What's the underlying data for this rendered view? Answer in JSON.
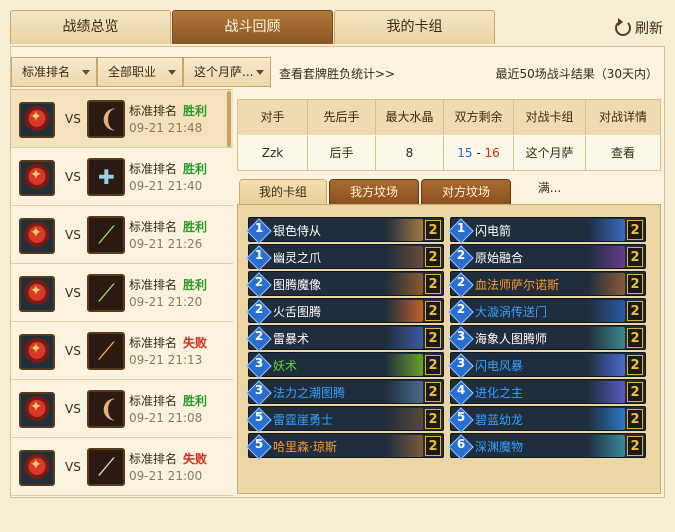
{
  "tabs": [
    "战绩总览",
    "战斗回顾",
    "我的卡组"
  ],
  "refresh_label": "刷新",
  "filters": {
    "mode": "标准排名",
    "class": "全部职业",
    "deck": "这个月萨..."
  },
  "stats_link": "查看套牌胜负统计>>",
  "summary": "最近50场战斗结果（30天内）",
  "matches": [
    {
      "vs": "VS",
      "mode": "标准排名",
      "result": "胜利",
      "time": "09-21 21:48"
    },
    {
      "vs": "VS",
      "mode": "标准排名",
      "result": "胜利",
      "time": "09-21 21:40"
    },
    {
      "vs": "VS",
      "mode": "标准排名",
      "result": "胜利",
      "time": "09-21 21:26"
    },
    {
      "vs": "VS",
      "mode": "标准排名",
      "result": "胜利",
      "time": "09-21 21:20"
    },
    {
      "vs": "VS",
      "mode": "标准排名",
      "result": "失败",
      "time": "09-21 21:13"
    },
    {
      "vs": "VS",
      "mode": "标准排名",
      "result": "胜利",
      "time": "09-21 21:08"
    },
    {
      "vs": "VS",
      "mode": "标准排名",
      "result": "失败",
      "time": "09-21 21:00"
    }
  ],
  "table": {
    "headers": [
      "对手",
      "先后手",
      "最大水晶",
      "双方剩余",
      "对战卡组",
      "对战详情"
    ],
    "opponent": "Zzk",
    "turn": "后手",
    "max_mana": "8",
    "remaining_mine": "15",
    "remaining_sep": " - ",
    "remaining_theirs": "16",
    "deck": "这个月萨满...",
    "detail": "查看"
  },
  "deck_tabs": [
    "我的卡组",
    "我方坟场",
    "对方坟场"
  ],
  "cards_left": [
    {
      "cost": "1",
      "name": "银色侍从",
      "count": "2",
      "art": "#a07a40"
    },
    {
      "cost": "1",
      "name": "幽灵之爪",
      "count": "2",
      "art": "#6a4a3a"
    },
    {
      "cost": "2",
      "name": "图腾魔像",
      "count": "2",
      "art": "#8a5a2a"
    },
    {
      "cost": "2",
      "name": "火舌图腾",
      "count": "2",
      "art": "#c0602a"
    },
    {
      "cost": "2",
      "name": "雷暴术",
      "count": "2",
      "art": "#3a5aa0"
    },
    {
      "cost": "3",
      "name": "妖术",
      "count": "2",
      "art": "#6aa02a"
    },
    {
      "cost": "3",
      "name": "法力之潮图腾",
      "count": "2",
      "art": "#4a6a8a"
    },
    {
      "cost": "5",
      "name": "雷霆崖勇士",
      "count": "2",
      "art": "#5a4a3a"
    },
    {
      "cost": "5",
      "name": "哈里森·琼斯",
      "count": "2",
      "art": "#7a5a3a"
    }
  ],
  "cards_right": [
    {
      "cost": "1",
      "name": "闪电箭",
      "count": "2",
      "art": "#3a6ac0"
    },
    {
      "cost": "2",
      "name": "原始融合",
      "count": "2",
      "art": "#6a3a8a"
    },
    {
      "cost": "2",
      "name": "血法师萨尔诺斯",
      "count": "2",
      "art": "#8a5a3a"
    },
    {
      "cost": "2",
      "name": "大漩涡传送门",
      "count": "2",
      "art": "#2a5aa0"
    },
    {
      "cost": "3",
      "name": "海象人图腾师",
      "count": "2",
      "art": "#3a8a8a"
    },
    {
      "cost": "3",
      "name": "闪电风暴",
      "count": "2",
      "art": "#4a6ad0"
    },
    {
      "cost": "4",
      "name": "进化之主",
      "count": "2",
      "art": "#5a5ac0"
    },
    {
      "cost": "5",
      "name": "碧蓝幼龙",
      "count": "2",
      "art": "#2a7ac0"
    },
    {
      "cost": "6",
      "name": "深渊魔物",
      "count": "2",
      "art": "#3a8a9a"
    }
  ]
}
